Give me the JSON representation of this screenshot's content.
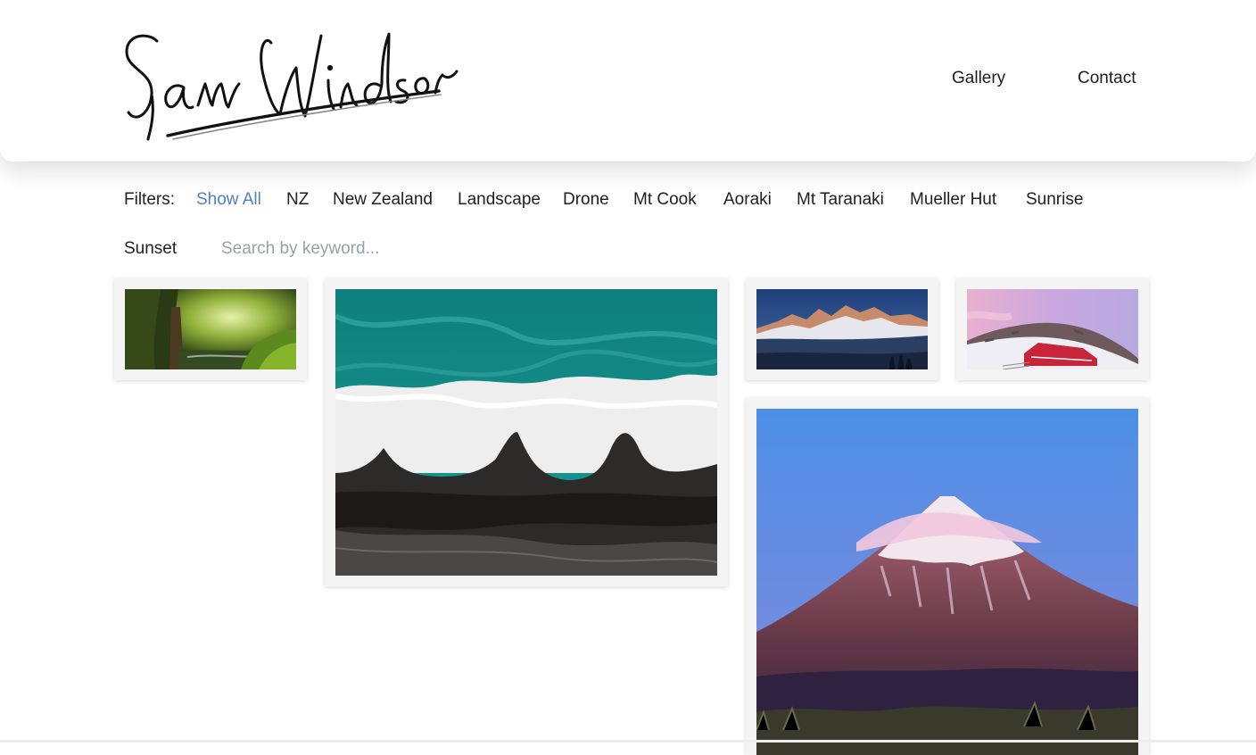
{
  "header": {
    "logo_text": "Sam Windsor",
    "nav": [
      "Gallery",
      "Contact"
    ]
  },
  "filters": {
    "label": "Filters:",
    "items": [
      "Show All",
      "NZ",
      "New Zealand",
      "Landscape",
      "Drone",
      "Mt Cook",
      "Aoraki",
      "Mt Taranaki",
      "Mueller Hut",
      "Sunrise",
      "Sunset"
    ],
    "active": "Show All",
    "search_placeholder": "Search by keyword..."
  },
  "gallery": {
    "photos": [
      {
        "subject": "forest stream"
      },
      {
        "subject": "aerial waves on black sand beach"
      },
      {
        "subject": "mountain range at sunrise"
      },
      {
        "subject": "red hut in snow"
      },
      {
        "subject": "snow capped volcano at dusk"
      }
    ]
  },
  "colors": {
    "active_filter": "#4f7fc6",
    "text": "#1e1e1e",
    "placeholder": "#9aa0a6",
    "card_bg": "#f4f4f4"
  }
}
